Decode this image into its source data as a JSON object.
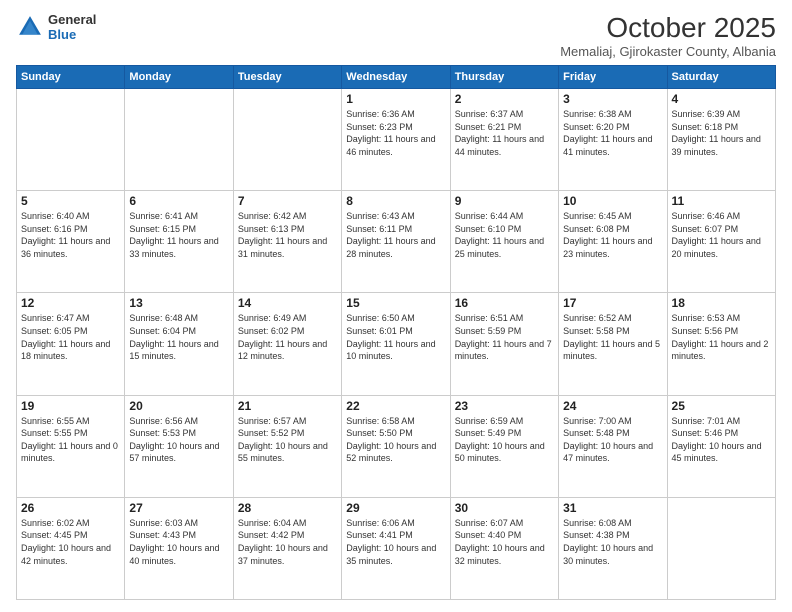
{
  "header": {
    "logo_general": "General",
    "logo_blue": "Blue",
    "month_title": "October 2025",
    "location": "Memaliaj, Gjirokaster County, Albania"
  },
  "weekdays": [
    "Sunday",
    "Monday",
    "Tuesday",
    "Wednesday",
    "Thursday",
    "Friday",
    "Saturday"
  ],
  "weeks": [
    [
      {
        "day": "",
        "info": ""
      },
      {
        "day": "",
        "info": ""
      },
      {
        "day": "",
        "info": ""
      },
      {
        "day": "1",
        "info": "Sunrise: 6:36 AM\nSunset: 6:23 PM\nDaylight: 11 hours and 46 minutes."
      },
      {
        "day": "2",
        "info": "Sunrise: 6:37 AM\nSunset: 6:21 PM\nDaylight: 11 hours and 44 minutes."
      },
      {
        "day": "3",
        "info": "Sunrise: 6:38 AM\nSunset: 6:20 PM\nDaylight: 11 hours and 41 minutes."
      },
      {
        "day": "4",
        "info": "Sunrise: 6:39 AM\nSunset: 6:18 PM\nDaylight: 11 hours and 39 minutes."
      }
    ],
    [
      {
        "day": "5",
        "info": "Sunrise: 6:40 AM\nSunset: 6:16 PM\nDaylight: 11 hours and 36 minutes."
      },
      {
        "day": "6",
        "info": "Sunrise: 6:41 AM\nSunset: 6:15 PM\nDaylight: 11 hours and 33 minutes."
      },
      {
        "day": "7",
        "info": "Sunrise: 6:42 AM\nSunset: 6:13 PM\nDaylight: 11 hours and 31 minutes."
      },
      {
        "day": "8",
        "info": "Sunrise: 6:43 AM\nSunset: 6:11 PM\nDaylight: 11 hours and 28 minutes."
      },
      {
        "day": "9",
        "info": "Sunrise: 6:44 AM\nSunset: 6:10 PM\nDaylight: 11 hours and 25 minutes."
      },
      {
        "day": "10",
        "info": "Sunrise: 6:45 AM\nSunset: 6:08 PM\nDaylight: 11 hours and 23 minutes."
      },
      {
        "day": "11",
        "info": "Sunrise: 6:46 AM\nSunset: 6:07 PM\nDaylight: 11 hours and 20 minutes."
      }
    ],
    [
      {
        "day": "12",
        "info": "Sunrise: 6:47 AM\nSunset: 6:05 PM\nDaylight: 11 hours and 18 minutes."
      },
      {
        "day": "13",
        "info": "Sunrise: 6:48 AM\nSunset: 6:04 PM\nDaylight: 11 hours and 15 minutes."
      },
      {
        "day": "14",
        "info": "Sunrise: 6:49 AM\nSunset: 6:02 PM\nDaylight: 11 hours and 12 minutes."
      },
      {
        "day": "15",
        "info": "Sunrise: 6:50 AM\nSunset: 6:01 PM\nDaylight: 11 hours and 10 minutes."
      },
      {
        "day": "16",
        "info": "Sunrise: 6:51 AM\nSunset: 5:59 PM\nDaylight: 11 hours and 7 minutes."
      },
      {
        "day": "17",
        "info": "Sunrise: 6:52 AM\nSunset: 5:58 PM\nDaylight: 11 hours and 5 minutes."
      },
      {
        "day": "18",
        "info": "Sunrise: 6:53 AM\nSunset: 5:56 PM\nDaylight: 11 hours and 2 minutes."
      }
    ],
    [
      {
        "day": "19",
        "info": "Sunrise: 6:55 AM\nSunset: 5:55 PM\nDaylight: 11 hours and 0 minutes."
      },
      {
        "day": "20",
        "info": "Sunrise: 6:56 AM\nSunset: 5:53 PM\nDaylight: 10 hours and 57 minutes."
      },
      {
        "day": "21",
        "info": "Sunrise: 6:57 AM\nSunset: 5:52 PM\nDaylight: 10 hours and 55 minutes."
      },
      {
        "day": "22",
        "info": "Sunrise: 6:58 AM\nSunset: 5:50 PM\nDaylight: 10 hours and 52 minutes."
      },
      {
        "day": "23",
        "info": "Sunrise: 6:59 AM\nSunset: 5:49 PM\nDaylight: 10 hours and 50 minutes."
      },
      {
        "day": "24",
        "info": "Sunrise: 7:00 AM\nSunset: 5:48 PM\nDaylight: 10 hours and 47 minutes."
      },
      {
        "day": "25",
        "info": "Sunrise: 7:01 AM\nSunset: 5:46 PM\nDaylight: 10 hours and 45 minutes."
      }
    ],
    [
      {
        "day": "26",
        "info": "Sunrise: 6:02 AM\nSunset: 4:45 PM\nDaylight: 10 hours and 42 minutes."
      },
      {
        "day": "27",
        "info": "Sunrise: 6:03 AM\nSunset: 4:43 PM\nDaylight: 10 hours and 40 minutes."
      },
      {
        "day": "28",
        "info": "Sunrise: 6:04 AM\nSunset: 4:42 PM\nDaylight: 10 hours and 37 minutes."
      },
      {
        "day": "29",
        "info": "Sunrise: 6:06 AM\nSunset: 4:41 PM\nDaylight: 10 hours and 35 minutes."
      },
      {
        "day": "30",
        "info": "Sunrise: 6:07 AM\nSunset: 4:40 PM\nDaylight: 10 hours and 32 minutes."
      },
      {
        "day": "31",
        "info": "Sunrise: 6:08 AM\nSunset: 4:38 PM\nDaylight: 10 hours and 30 minutes."
      },
      {
        "day": "",
        "info": ""
      }
    ]
  ]
}
